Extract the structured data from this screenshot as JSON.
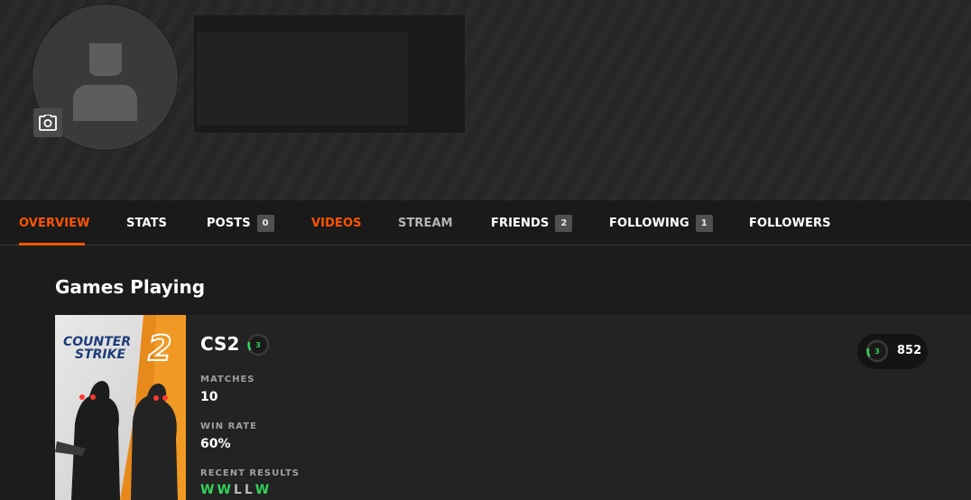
{
  "profile": {
    "avatar_icon": "user-silhouette-icon",
    "camera_icon": "camera-icon"
  },
  "tabs": [
    {
      "label": "OVERVIEW",
      "badge": null,
      "active": true
    },
    {
      "label": "STATS",
      "badge": null
    },
    {
      "label": "POSTS",
      "badge": "0"
    },
    {
      "label": "VIDEOS",
      "badge": null
    },
    {
      "label": "STREAM",
      "badge": null
    },
    {
      "label": "FRIENDS",
      "badge": "2"
    },
    {
      "label": "FOLLOWING",
      "badge": "1"
    },
    {
      "label": "FOLLOWERS",
      "badge": null
    }
  ],
  "games_section": {
    "title": "Games Playing",
    "game": {
      "name": "CS2",
      "cover_title_line1": "COUNTER",
      "cover_title_line2": "STRIKE",
      "cover_title_number": "2",
      "level": "3",
      "matches_label": "MATCHES",
      "matches": "10",
      "win_rate_label": "WIN RATE",
      "win_rate": "60%",
      "recent_results_label": "RECENT RESULTS",
      "recent_results": [
        "W",
        "W",
        "L",
        "L",
        "W"
      ],
      "elo_level": "3",
      "elo": "852"
    }
  },
  "colors": {
    "accent": "#ff5500",
    "win": "#32d35a",
    "loss": "#b8b8b8",
    "level_green": "#32d35a"
  }
}
